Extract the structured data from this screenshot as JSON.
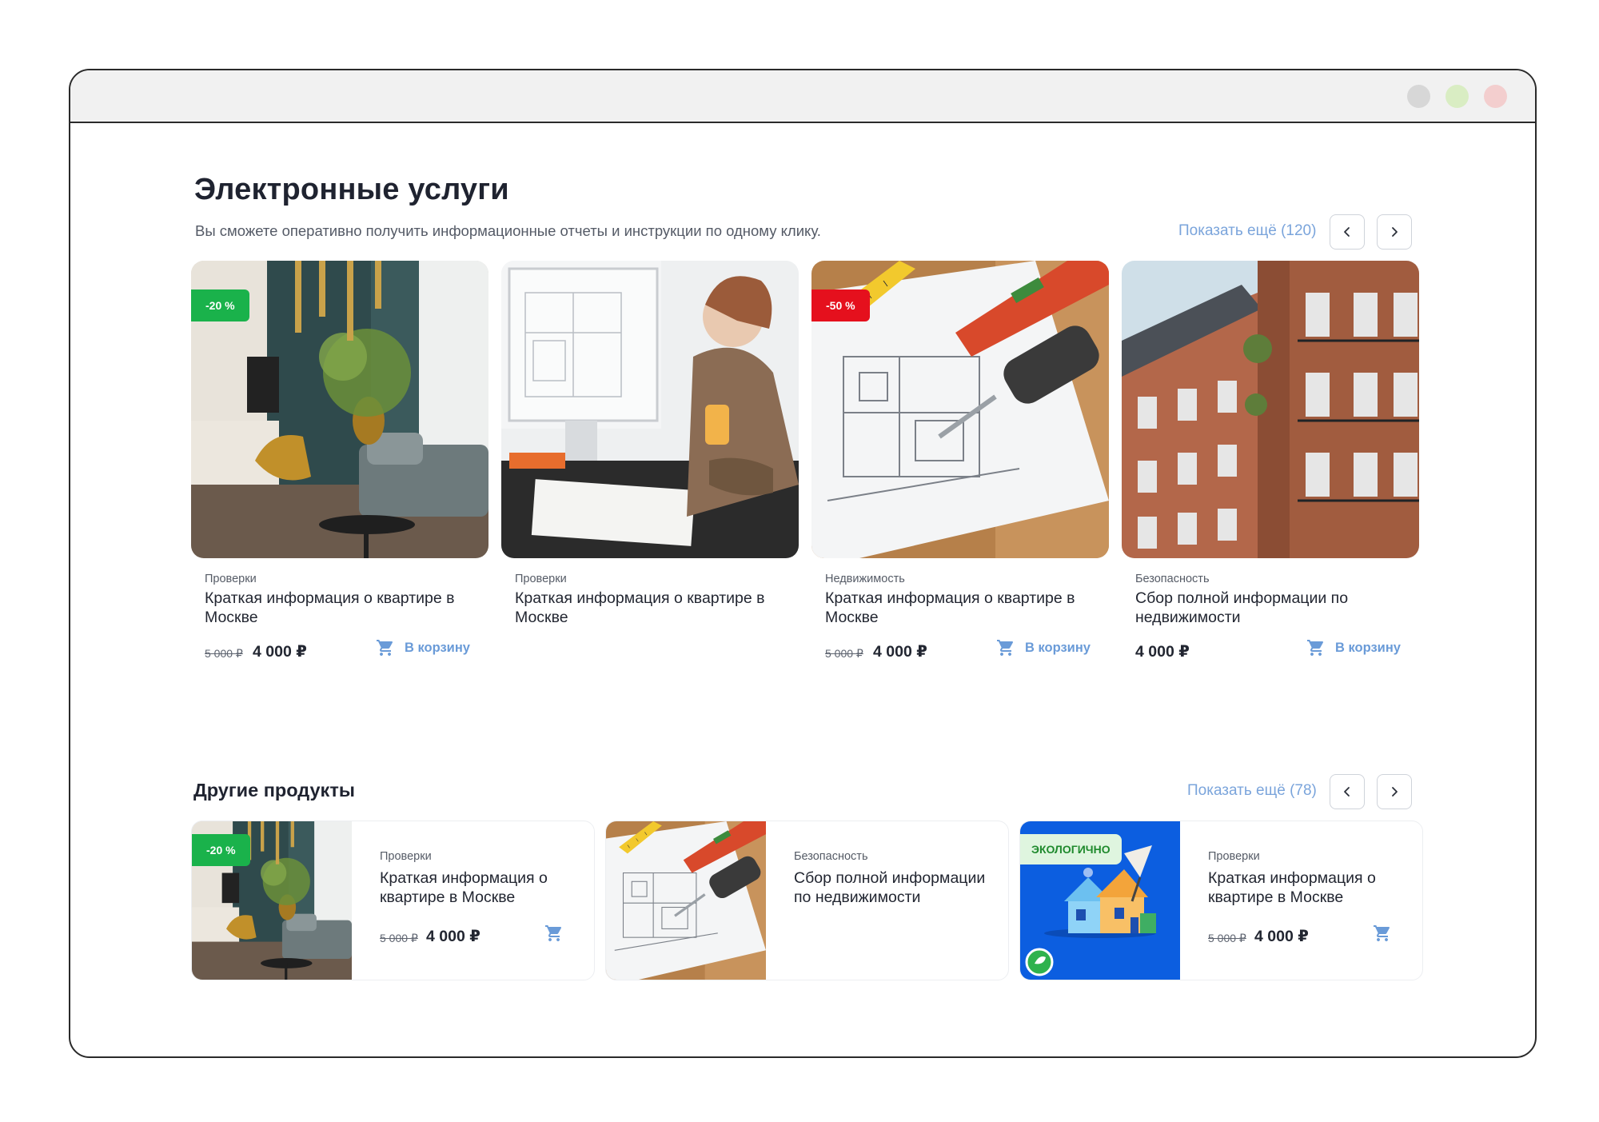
{
  "section": {
    "title": "Электронные услуги",
    "subtitle": "Вы сможете оперативно получить информационные отчеты и инструкции по одному клику.",
    "show_more": "Показать ещё (120)"
  },
  "cards": [
    {
      "badge": "-20 %",
      "category": "Проверки",
      "title": "Краткая информация о квартире в Москве",
      "old_price": "5 000 ₽",
      "price": "4 000 ₽",
      "cart_label": "В корзину"
    },
    {
      "category": "Проверки",
      "title": "Краткая информация о квартире в Москве"
    },
    {
      "badge": "-50 %",
      "category": "Недвижимость",
      "title": "Краткая информация о квартире в Москве",
      "old_price": "5 000 ₽",
      "price": "4 000 ₽",
      "cart_label": "В корзину"
    },
    {
      "category": "Безопасность",
      "title": "Сбор полной информации по недвижимости",
      "price": "4 000 ₽",
      "cart_label": "В корзину"
    }
  ],
  "other": {
    "title": "Другие продукты",
    "show_more": "Показать ещё (78)",
    "items": [
      {
        "badge": "-20 %",
        "category": "Проверки",
        "title": "Краткая информация о квартире в Москве",
        "old_price": "5 000 ₽",
        "price": "4 000 ₽"
      },
      {
        "category": "Безопасность",
        "title": "Сбор полной информации по недвижимости"
      },
      {
        "badge": "ЭКОЛОГИЧНО",
        "category": "Проверки",
        "title": "Краткая информация о квартире в Москве",
        "old_price": "5 000 ₽",
        "price": "4 000 ₽"
      }
    ]
  },
  "colors": {
    "accent": "#6a9bd8",
    "badge_green": "#1ab24b",
    "badge_red": "#e5101d",
    "eco_bg": "#0c5ee0"
  }
}
